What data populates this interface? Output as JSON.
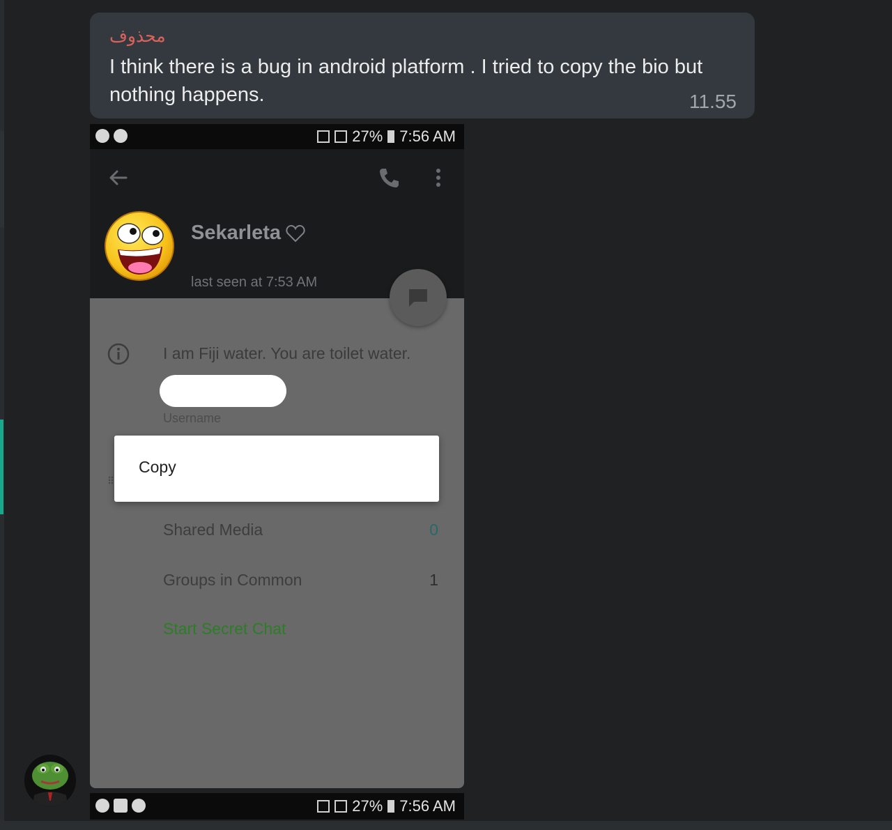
{
  "message": {
    "sender": "محذوف",
    "text": "I think there is a bug in android platform . I tried to copy the bio but nothing happens.",
    "time": "11.55"
  },
  "screenshot": {
    "statusbar": {
      "battery": "27%",
      "time": "7:56 AM"
    },
    "contact": {
      "name": "Sekarleta",
      "last_seen": "last seen at 7:53 AM"
    },
    "bio": "I am Fiji water. You are toilet water.",
    "username_label": "Username",
    "context_menu": {
      "copy": "Copy"
    },
    "rows": [
      {
        "label": "Shared Media",
        "count": "0"
      },
      {
        "label": "Groups in Common",
        "count": "1"
      }
    ],
    "secret_chat": "Start Secret Chat",
    "colors": {
      "accent_green": "#2c7d26",
      "count_teal": "#256a66"
    }
  },
  "statusbar_bottom": {
    "battery": "27%",
    "time": "7:56 AM"
  }
}
